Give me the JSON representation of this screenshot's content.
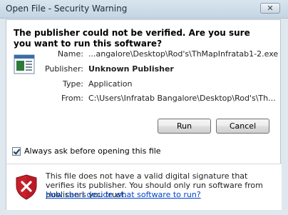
{
  "window": {
    "title": "Open File - Security Warning",
    "close_glyph": "✕"
  },
  "headline": "The publisher could not be verified.  Are you sure you want to run this software?",
  "file_icon": "application-window-icon",
  "details": {
    "name": {
      "label": "Name:",
      "value": "...angalore\\Desktop\\Rod's\\ThMapInfratab1-2.exe"
    },
    "publisher": {
      "label": "Publisher:",
      "value": "Unknown Publisher"
    },
    "type": {
      "label": "Type:",
      "value": "Application"
    },
    "from": {
      "label": "From:",
      "value": "C:\\Users\\Infratab Bangalore\\Desktop\\Rod's\\Th..."
    }
  },
  "buttons": {
    "run": "Run",
    "cancel": "Cancel"
  },
  "checkbox": {
    "label": "Always ask before opening this file",
    "checked": true
  },
  "footer": {
    "icon": "shield-x-icon",
    "warning": "This file does not have a valid digital signature that verifies its publisher.  You should only run software from publishers you trust.",
    "link": "How can I decide what software to run?"
  },
  "colors": {
    "shield": "#c8202a",
    "link": "#0044cc"
  }
}
